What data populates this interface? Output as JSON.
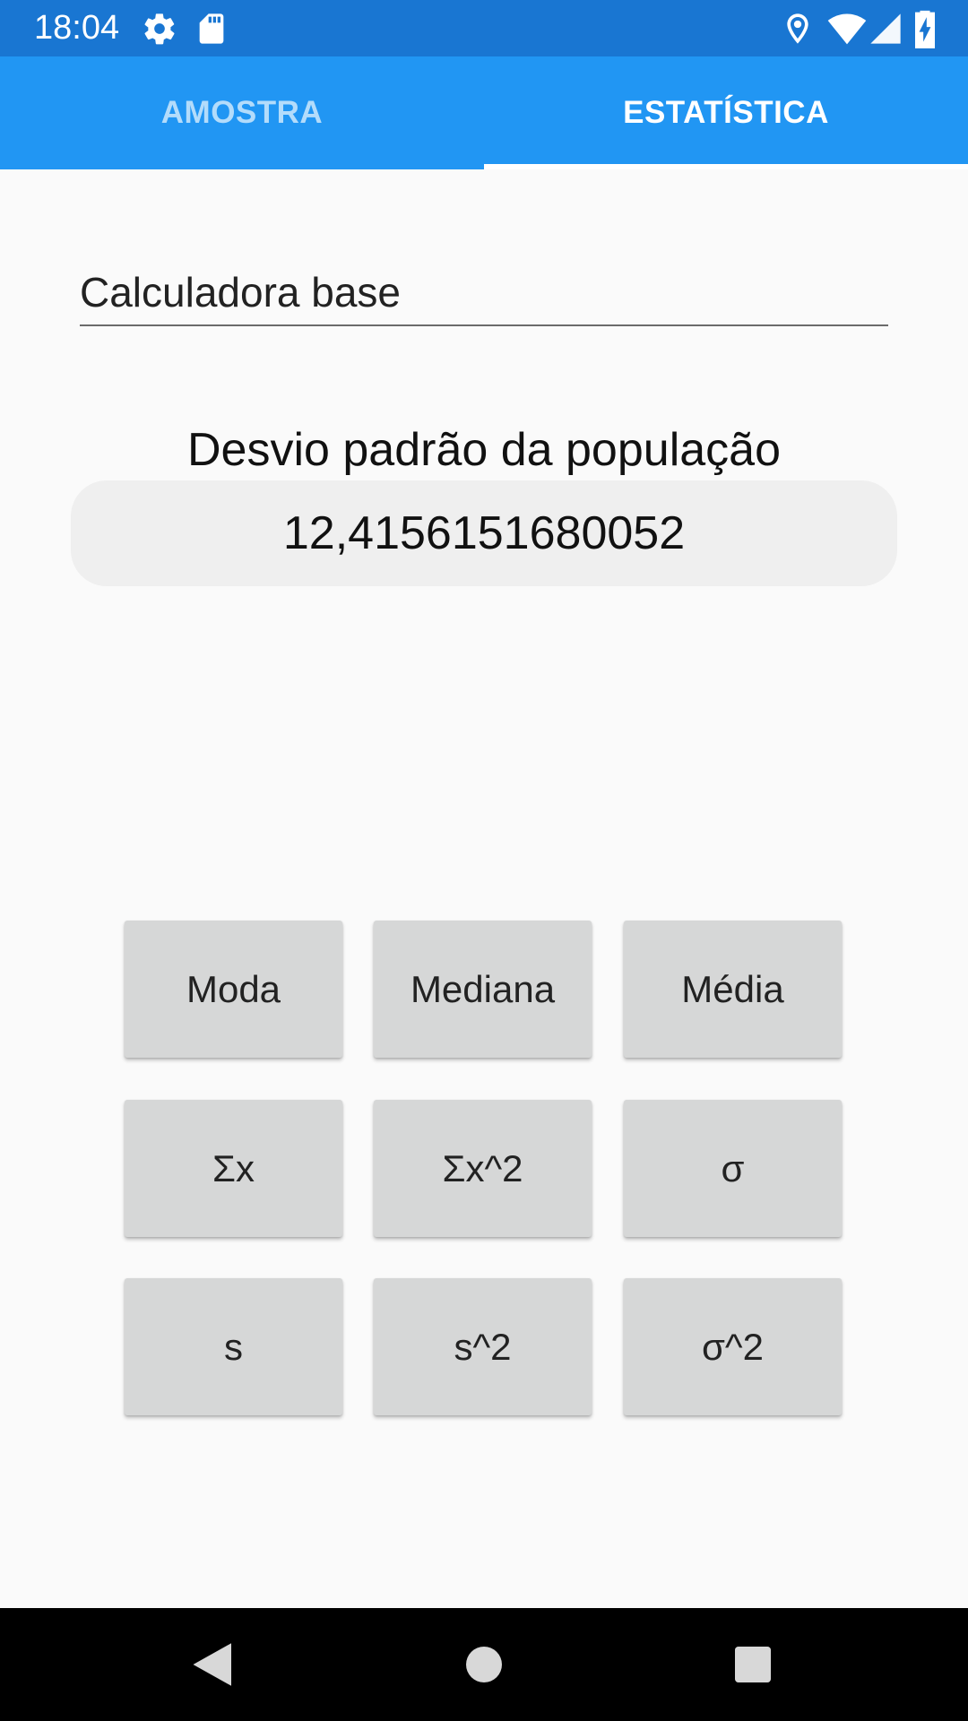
{
  "status_bar": {
    "time": "18:04",
    "icons": [
      "gear-icon",
      "sd-card-icon",
      "location-icon",
      "wifi-icon",
      "signal-icon",
      "battery-charging-icon"
    ]
  },
  "tabs": [
    {
      "label": "AMOSTRA",
      "selected": false
    },
    {
      "label": "ESTATÍSTICA",
      "selected": true
    }
  ],
  "input": {
    "value": "Calculadora base"
  },
  "result": {
    "title": "Desvio padrão da população",
    "value": "12,4156151680052"
  },
  "buttons": [
    [
      "Moda",
      "Mediana",
      "Média"
    ],
    [
      "Σx",
      "Σx^2",
      "σ"
    ],
    [
      "s",
      "s^2",
      "σ^2"
    ]
  ],
  "nav_bar": {
    "icons": [
      "back-icon",
      "home-icon",
      "recents-icon"
    ]
  },
  "colors": {
    "status_bar": "#1976d2",
    "tab_bar": "#2196f3",
    "background": "#fafafa",
    "button": "#d6d7d7"
  }
}
